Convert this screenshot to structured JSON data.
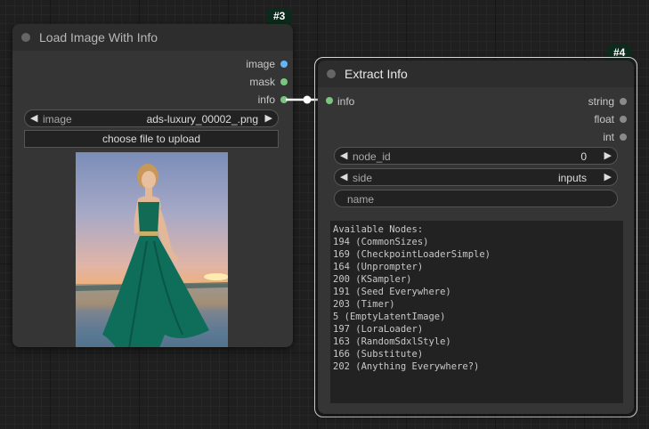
{
  "node3": {
    "badge": "#3",
    "title": "Load Image With Info",
    "outputs": [
      "image",
      "mask",
      "info"
    ],
    "output_colors": [
      "#64b5f6",
      "#7bc67e",
      "#7bc67e"
    ],
    "image_widget": {
      "label": "image",
      "value": "ads-luxury_00002_.png"
    },
    "upload_label": "choose file to upload"
  },
  "node4": {
    "badge": "#4",
    "title": "Extract Info",
    "input": "info",
    "input_color": "#7bc67e",
    "outputs": [
      "string",
      "float",
      "int"
    ],
    "node_id": {
      "label": "node_id",
      "value": "0"
    },
    "side": {
      "label": "side",
      "value": "inputs"
    },
    "name_placeholder": "name",
    "text": "Available Nodes:\n194 (CommonSizes)\n169 (CheckpointLoaderSimple)\n164 (Unprompter)\n200 (KSampler)\n191 (Seed Everywhere)\n203 (Timer)\n5 (EmptyLatentImage)\n197 (LoraLoader)\n163 (RandomSdxlStyle)\n166 (Substitute)\n202 (Anything Everywhere?)"
  }
}
